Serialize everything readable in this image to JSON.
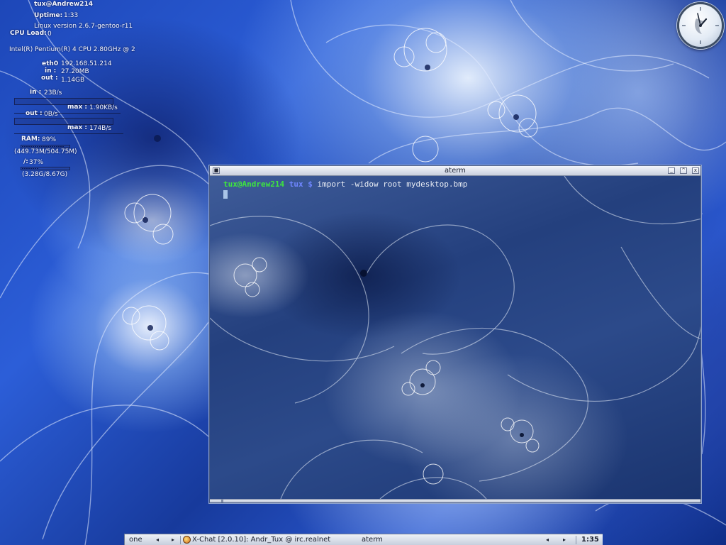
{
  "sysmon": {
    "user_host": "tux@Andrew214",
    "uptime_label": "Uptime:",
    "uptime_value": "1:33",
    "kernel": "Linux version 2.6.7-gentoo-r11",
    "cpu_label": "CPU Load:",
    "cpu_value": "0",
    "cpu_model": "Intel(R) Pentium(R) 4 CPU 2.80GHz @ 2",
    "iface_label": "eth0",
    "iface_ip": "192.168.51.214",
    "total_in_label": "in :",
    "total_in_value": "27.20MB",
    "total_out_label": "out :",
    "total_out_value": "1.14GB",
    "rate_in_label": "in :",
    "rate_in_value": "23B/s",
    "rate_in_max_label": "max :",
    "rate_in_max_value": "1.90KB/s",
    "rate_out_label": "out :",
    "rate_out_value": "0B/s",
    "rate_out_max_label": "max :",
    "rate_out_max_value": "174B/s",
    "ram_label": "RAM:",
    "ram_percent": "89%",
    "ram_fraction": 0.89,
    "ram_detail": "(449.73M/504.75M)",
    "disk_label": "/:",
    "disk_percent": "37%",
    "disk_fraction": 0.37,
    "disk_detail": "(3.28G/8.67G)"
  },
  "terminal": {
    "title": "aterm",
    "prompt_user": "tux@Andrew214",
    "prompt_cwd": "tux",
    "prompt_symbol": "$",
    "command": "import -widow root mydesktop.bmp",
    "minimize_glyph": "_",
    "maximize_glyph": "^",
    "close_glyph": "x",
    "menu_glyph": "■"
  },
  "taskbar": {
    "workspace": "one",
    "left_arrow": "◂",
    "right_arrow": "▸",
    "task_xchat": "X-Chat [2.0.10]: Andr_Tux @ irc.realnet",
    "task_aterm": "aterm",
    "clock": "1:35"
  },
  "colors": {
    "prompt_user": "#3ee63e",
    "prompt_cwd": "#6f86ff"
  }
}
